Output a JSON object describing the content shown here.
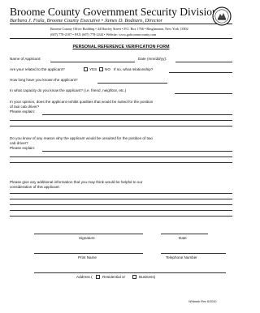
{
  "header": {
    "title": "Broome County Government Security Division",
    "subtitle": "Barbara J. Fiala, Broome County Executive • James D. Bodnaro, Director",
    "address_line1": "Broome County Office Building • 44 Hawley Street • P.O. Box 1766 • Binghamton, New York 13902",
    "address_line2": "(607) 778-2107 • FAX (607) 778-2244 • Website: www.gobroomecounty.com"
  },
  "form": {
    "title": "PERSONAL REFERENCE VERIFICATION FORM",
    "name_label": "Name of Applicant:",
    "date_label": "Date (mm/dd/yy):",
    "related_label": "Are your related to the applicant?",
    "yes_label": "YES",
    "no_label": "NO",
    "relationship_label": "If so, what relationship?",
    "how_long_label": "How long have you known the applicant?",
    "capacity_label": "In what capacity do you know the applicant? (i.e. friend, neighbor, etc.)",
    "q1_line1": "In your opinion, does the applicant exhibit qualities that would be suited for the position",
    "q1_line2": "of taxi cab driver?",
    "explain_label": "Please explain:",
    "q2_line1": "Do you know of any reason why the applicant would be unsuited for the position of taxi",
    "q2_line2": "cab driver?",
    "q3_line1": "Please give any additional information that you may think would be helpful to our",
    "q3_line2": "consideration of this applicant:",
    "signature_label": "Signature",
    "date_caption": "Date",
    "print_name_label": "Print Name",
    "telephone_label": "Telephone Number",
    "address_label": "Address (",
    "residential_label": "Residential or",
    "business_label": "Business)"
  },
  "footer": {
    "form_id": "Whbank Rev 6/2010"
  }
}
